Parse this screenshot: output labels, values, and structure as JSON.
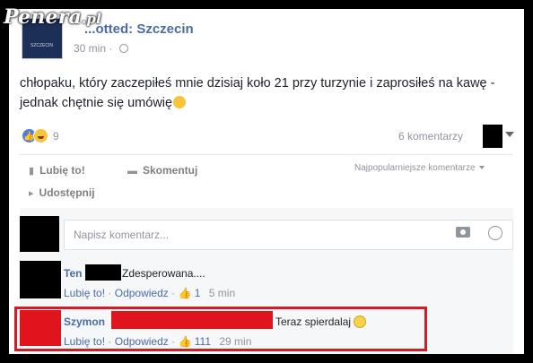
{
  "watermark": {
    "text": "Penera",
    "suffix": ".pl"
  },
  "post": {
    "page_name": "...otted: Szczecin",
    "avatar_text": "SZCZECIN",
    "time": "30 min · ",
    "text_main": "chłopaku, który zaczepiłeś mnie dzisiaj koło 21 przy turzynie i zaprosiłeś na kawę - jednak chętnie się umówię",
    "reaction_count": "9",
    "comments_count": "6 komentarzy",
    "like_label": "Lubię to!",
    "comment_label": "Skomentuj",
    "share_label": "Udostępnij",
    "sort_label": "Najpopularniejsze komentarze"
  },
  "composer": {
    "placeholder": "Napisz komentarz..."
  },
  "comments": [
    {
      "author": "Ten",
      "text": "Zdesperowana....",
      "like": "Lubię to!",
      "reply": "Odpowiedz",
      "likes": "1",
      "time": "5 min"
    },
    {
      "author": "Szymon",
      "text": "Teraz spierdalaj",
      "like": "Lubię to!",
      "reply": "Odpowiedz",
      "likes": "111",
      "time": "29 min"
    }
  ],
  "colors": {
    "link": "#4b6aa8",
    "highlight": "#d01d27",
    "redaction": "#000000",
    "redaction_red": "#e0141c"
  }
}
